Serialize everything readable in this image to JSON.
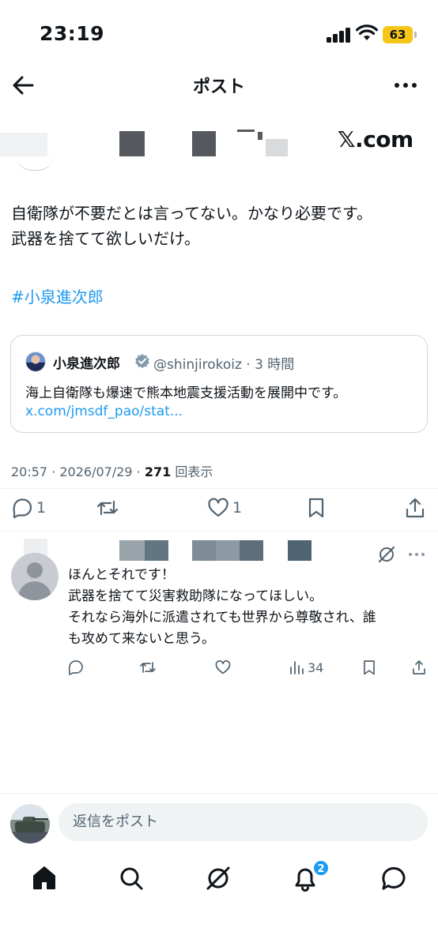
{
  "status_bar": {
    "time": "23:19",
    "battery": "63",
    "battery_color": "#f5c518"
  },
  "header": {
    "title": "ポスト",
    "back_icon": "arrow-left-icon",
    "more_icon": "more-horizontal-icon"
  },
  "author": {
    "source_label": "𝕏.com"
  },
  "post": {
    "text_line1": "自衛隊が不要だとは言ってない。かなり必要です。",
    "text_line2": "武器を捨てて欲しいだけ。",
    "hashtag": "#小泉進次郎"
  },
  "quote": {
    "name": "小泉進次郎",
    "handle": "@shinjirokoiz · 3 時間",
    "text": "海上自衛隊も爆速で熊本地震支援活動を展開中です。",
    "link": "x.com/jmsdf_pao/stat..."
  },
  "meta": {
    "time_date": "20:57 · 2026/07/29 · ",
    "views_count": "271",
    "views_label": " 回表示"
  },
  "actions": {
    "reply_count": "1",
    "like_count": "1"
  },
  "reply": {
    "line1": "ほんとそれです！",
    "line2": "武器を捨てて災害救助隊になってほしい。",
    "line3": "それなら海外に派遣されても世界から尊敬され、誰",
    "line4": "も攻めて来ないと思う。",
    "views_count": "34"
  },
  "composer": {
    "placeholder": "返信をポスト"
  },
  "nav": {
    "notifications_badge": "2"
  },
  "colors": {
    "accent": "#1d9bf0",
    "text": "#0f1419",
    "muted": "#536471",
    "border": "#cfd9de"
  }
}
